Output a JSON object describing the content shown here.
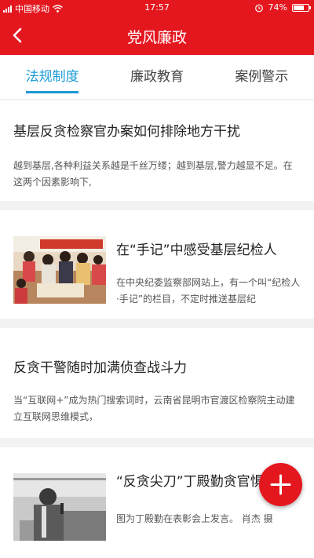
{
  "status_bar": {
    "carrier": "中国移动",
    "time": "17:57",
    "battery": "74%",
    "battery_level": 0.74
  },
  "nav": {
    "title": "党风廉政",
    "back_icon": "back-arrow-icon"
  },
  "tabs": [
    {
      "label": "法规制度",
      "active": true
    },
    {
      "label": "廉政教育",
      "active": false
    },
    {
      "label": "案例警示",
      "active": false
    }
  ],
  "articles": [
    {
      "title": "基层反贪检察官办案如何排除地方干扰",
      "summary": "越到基层,各种利益关系越是千丝万缕；越到基层,警力越显不足。在这两个因素影响下,"
    },
    {
      "title": "在“手记”中感受基层纪检人",
      "summary": "在中央纪委监察部网站上，有一个叫“纪检人·手记”的栏目，不定时推送基层纪",
      "image": "photo-group-of-people"
    },
    {
      "title": "反贪干警随时加满侦查战斗力",
      "summary": "当“互联网+”成为热门搜索词时，云南省昆明市官渡区检察院主动建立互联网思维模式，"
    },
    {
      "title": "“反贪尖刀”丁殿勤贪官惧怕爱",
      "summary": "图为丁殿勤在表彰会上发言。 肖杰 摄",
      "image": "photo-speaker-at-podium"
    }
  ],
  "fab": {
    "icon": "plus-icon"
  },
  "colors": {
    "brand_red": "#e4171f",
    "tab_active": "#1a9ad6"
  }
}
